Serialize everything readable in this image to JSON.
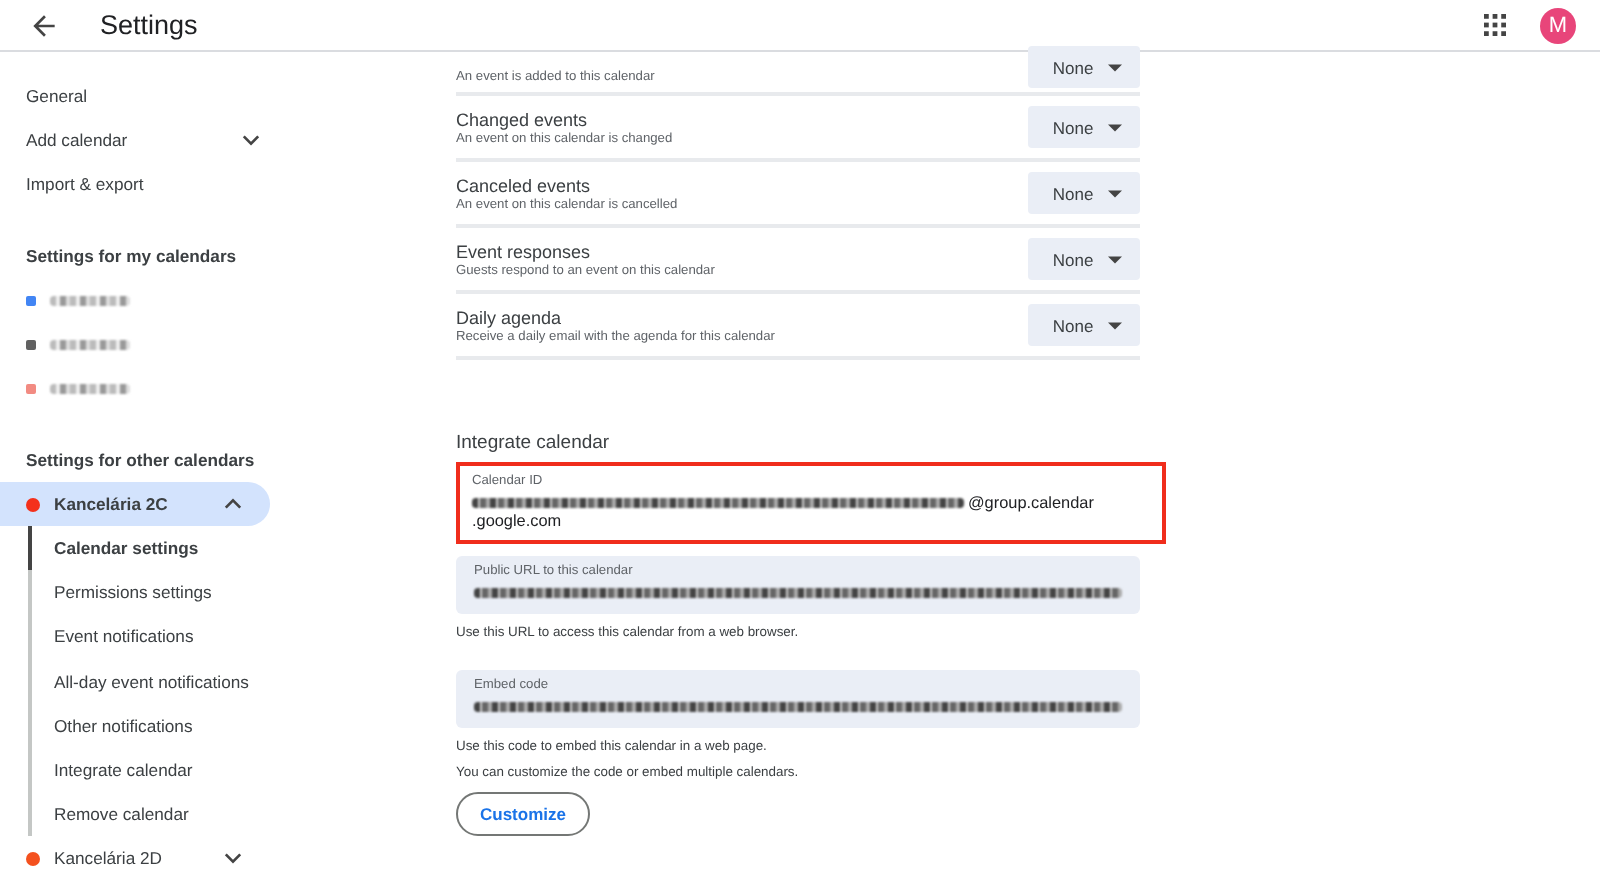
{
  "header": {
    "title": "Settings",
    "avatar": "M"
  },
  "sidebar": {
    "top_items": [
      {
        "label": "General",
        "kind": "link"
      },
      {
        "label": "Add calendar",
        "kind": "expander"
      },
      {
        "label": "Import & export",
        "kind": "link"
      }
    ],
    "my_calendars": {
      "heading": "Settings for my calendars",
      "items": [
        {
          "color": "#4285f4"
        },
        {
          "color": "#616161"
        },
        {
          "color": "#f28b82"
        }
      ]
    },
    "other_calendars": {
      "heading": "Settings for other calendars",
      "items": [
        {
          "label": "Kancelária 2C",
          "color": "#f4301b",
          "selected": true,
          "expanded": true,
          "children": [
            {
              "label": "Calendar settings",
              "selected": true
            },
            {
              "label": "Permissions settings",
              "selected": false
            },
            {
              "label": "Event notifications",
              "selected": false
            },
            {
              "label": "All-day event notifications",
              "selected": false
            },
            {
              "label": "Other notifications",
              "selected": false
            },
            {
              "label": "Integrate calendar",
              "selected": false
            },
            {
              "label": "Remove calendar",
              "selected": false
            }
          ]
        },
        {
          "label": "Kancelária 2D",
          "color": "#f4511e",
          "selected": false,
          "expanded": false
        }
      ]
    }
  },
  "notifications": [
    {
      "description": "An event is added to this calendar",
      "value": "None"
    },
    {
      "title": "Changed events",
      "description": "An event on this calendar is changed",
      "value": "None"
    },
    {
      "title": "Canceled events",
      "description": "An event on this calendar is cancelled",
      "value": "None"
    },
    {
      "title": "Event responses",
      "description": "Guests respond to an event on this calendar",
      "value": "None"
    },
    {
      "title": "Daily agenda",
      "description": "Receive a daily email with the agenda for this calendar",
      "value": "None"
    }
  ],
  "integrate": {
    "heading": "Integrate calendar",
    "calendar_id": {
      "label": "Calendar ID",
      "highlighted": true,
      "suffix": "@group.calendar",
      "continuation": ".google.com"
    },
    "public_url": {
      "label": "Public URL to this calendar",
      "hints": [
        "Use this URL to access this calendar from a web browser."
      ]
    },
    "embed": {
      "label": "Embed code",
      "hints": [
        "Use this code to embed this calendar in a web page.",
        "You can customize the code or embed multiple calendars."
      ]
    },
    "button": "Customize"
  }
}
